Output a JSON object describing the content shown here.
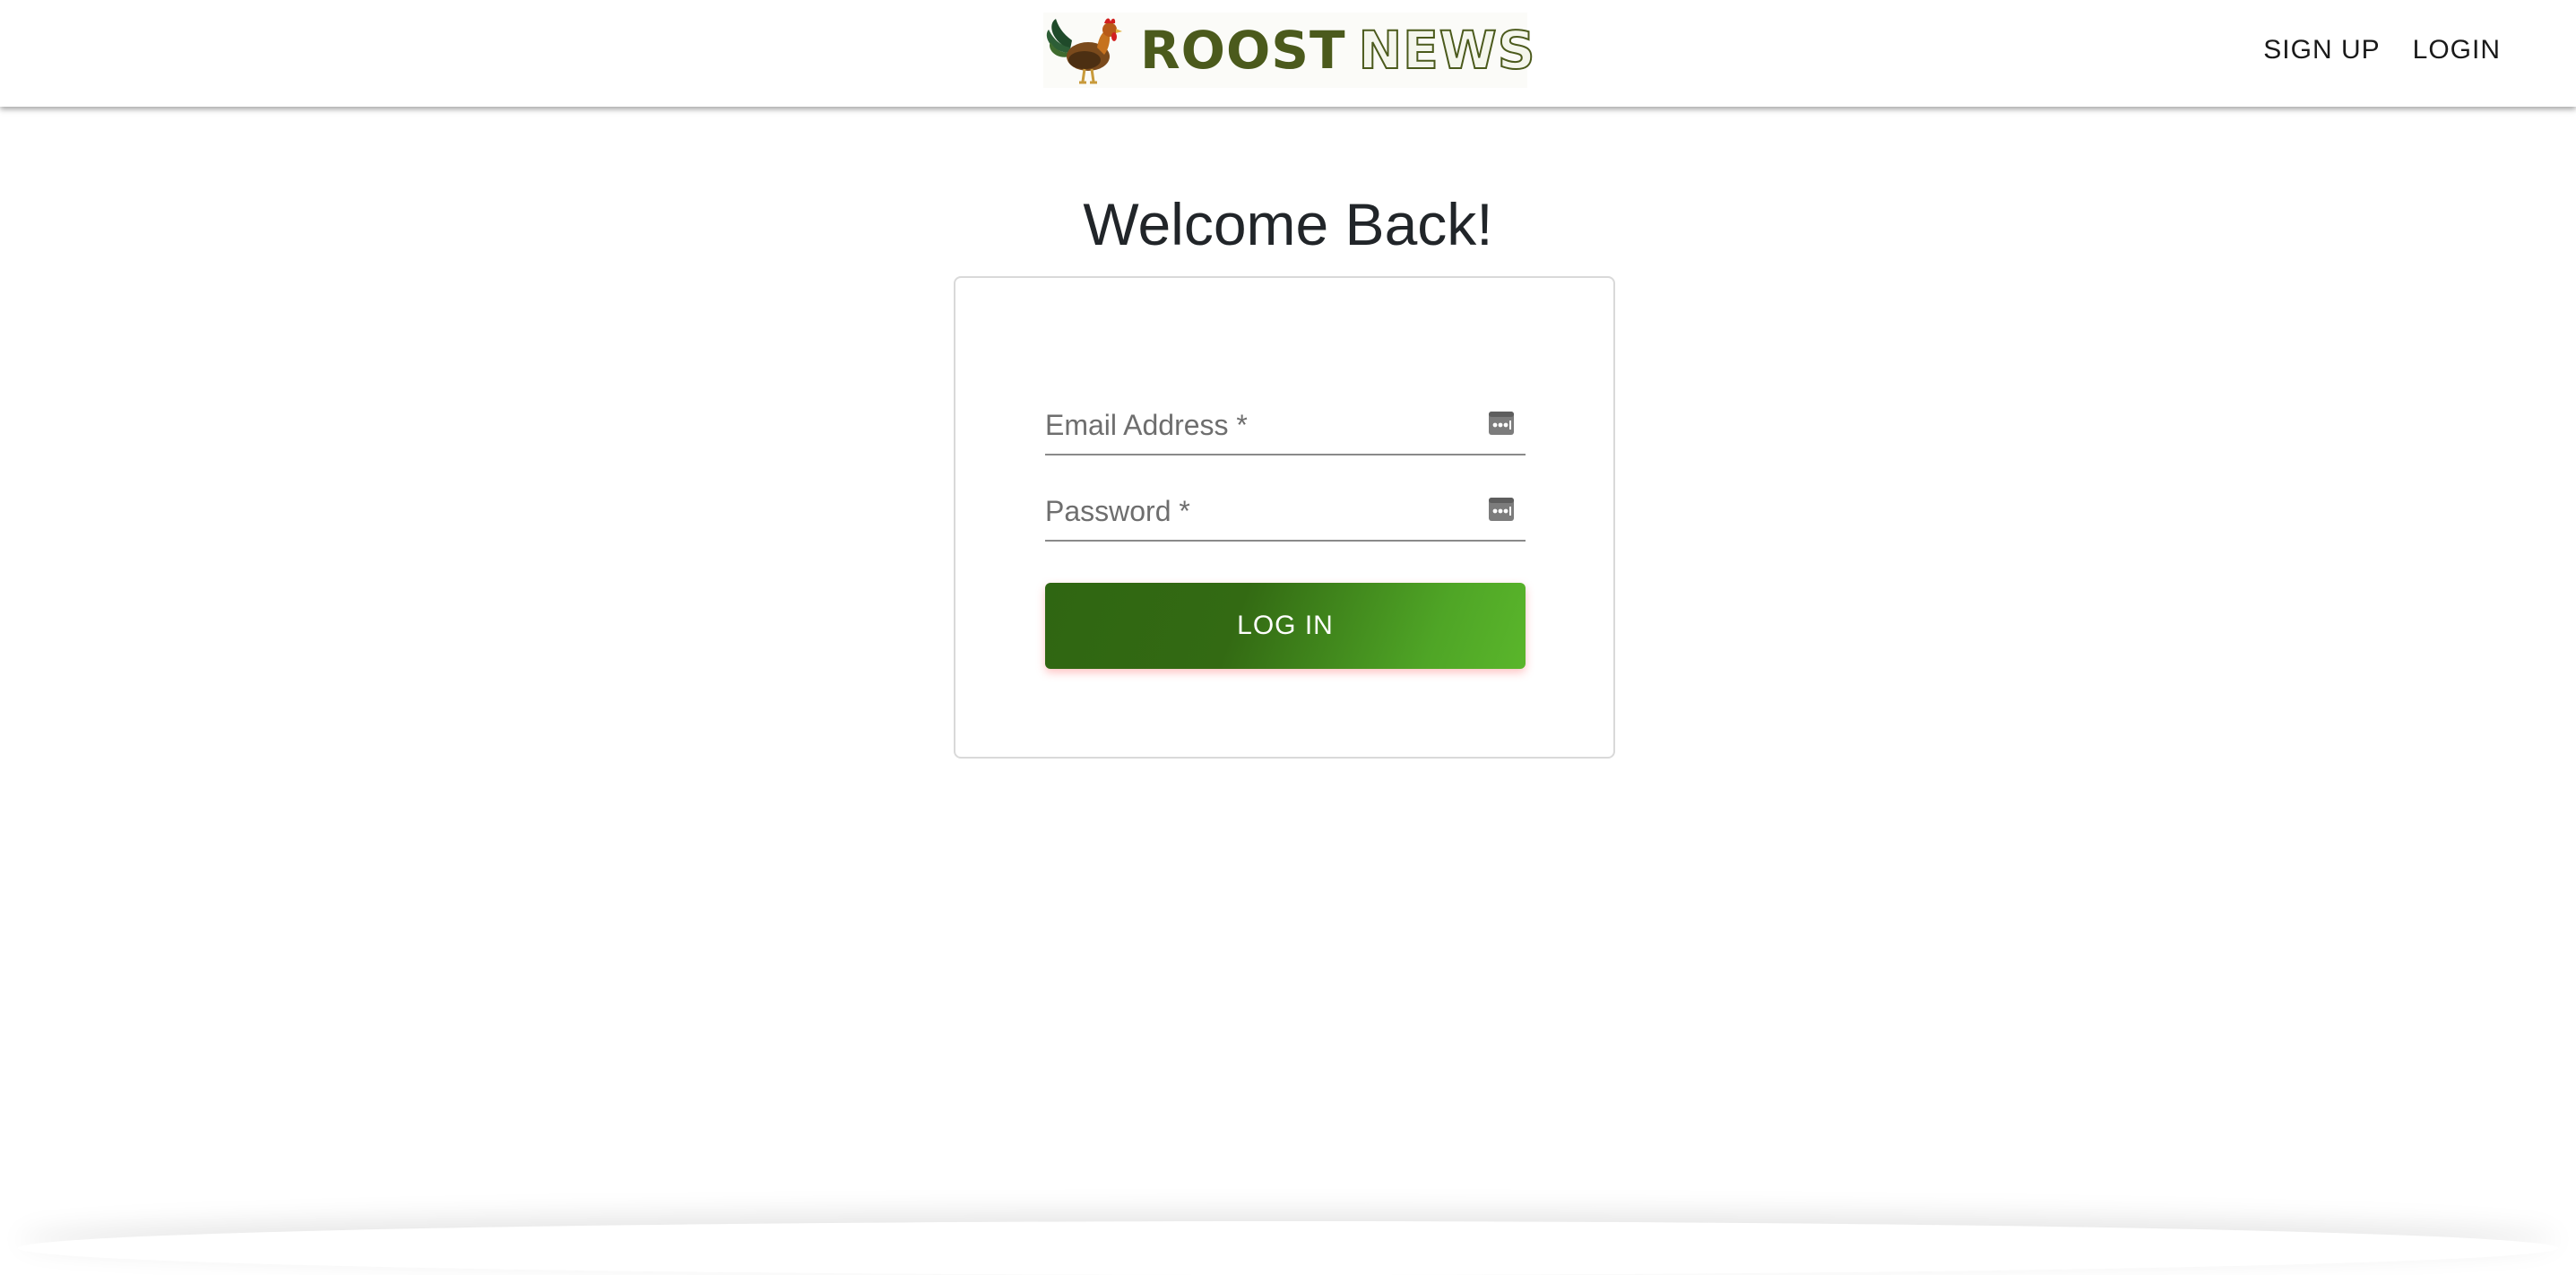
{
  "header": {
    "logo": {
      "word1": "ROOST",
      "word2": "NEWS",
      "brand_color": "#4b5a1c",
      "icon": "rooster-icon"
    },
    "nav": {
      "signup": "SIGN UP",
      "login": "LOGIN"
    }
  },
  "main": {
    "title": "Welcome Back!",
    "form": {
      "email": {
        "placeholder": "Email Address *",
        "value": "",
        "icon": "password-manager-icon"
      },
      "password": {
        "placeholder": "Password *",
        "value": "",
        "icon": "password-manager-icon"
      },
      "submit_label": "LOG IN",
      "submit_colors": [
        "#336a13",
        "#5ab62b"
      ]
    }
  }
}
